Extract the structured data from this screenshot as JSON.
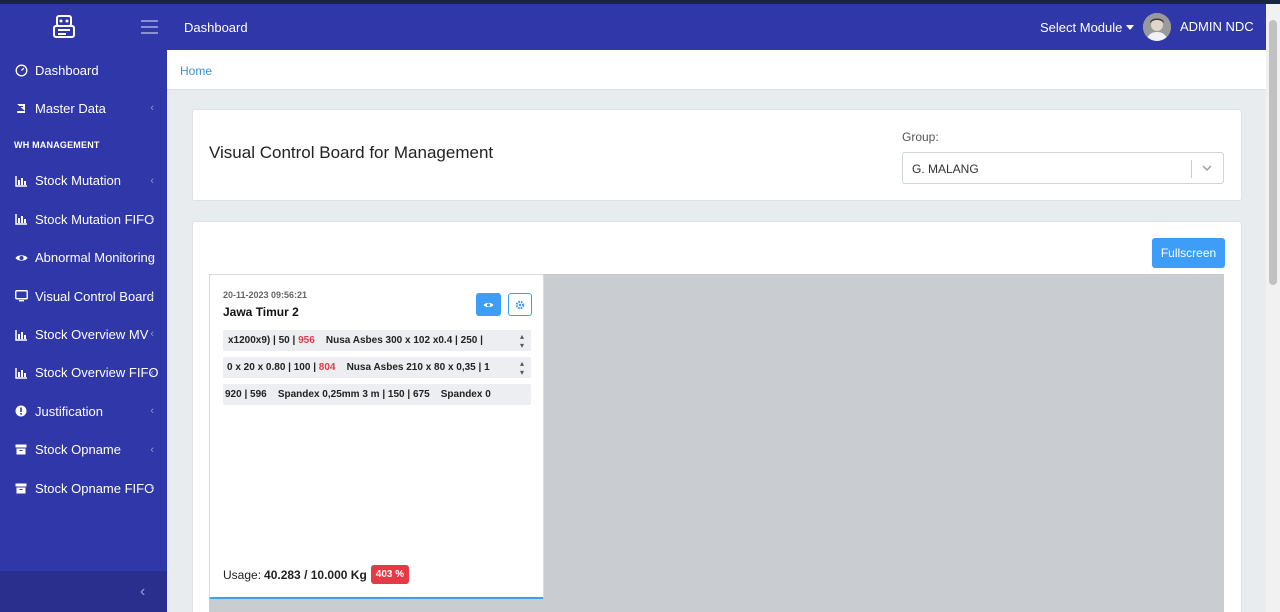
{
  "topbar": {
    "title": "Dashboard",
    "module_select": "Select Module",
    "user_name": "ADMIN NDC"
  },
  "sidebar": {
    "items": [
      {
        "label": "Dashboard",
        "icon": "dashboard-icon",
        "has_chevron": false
      },
      {
        "label": "Master Data",
        "icon": "book-icon",
        "has_chevron": true
      }
    ],
    "section_header": "WH MANAGEMENT",
    "wh_items": [
      {
        "label": "Stock Mutation",
        "icon": "bar-chart-icon"
      },
      {
        "label": "Stock Mutation FIFO",
        "icon": "bar-chart-icon"
      },
      {
        "label": "Abnormal Monitoring",
        "icon": "eye-icon"
      },
      {
        "label": "Visual Control Board",
        "icon": "monitor-icon"
      },
      {
        "label": "Stock Overview MV",
        "icon": "bar-chart-icon"
      },
      {
        "label": "Stock Overview FIFO",
        "icon": "bar-chart-icon"
      },
      {
        "label": "Justification",
        "icon": "exclamation-circle-icon"
      },
      {
        "label": "Stock Opname",
        "icon": "archive-icon"
      },
      {
        "label": "Stock Opname FIFO",
        "icon": "archive-icon"
      }
    ]
  },
  "breadcrumb": {
    "home": "Home"
  },
  "header_card": {
    "title": "Visual Control Board for Management",
    "group_label": "Group:",
    "group_value": "G. MALANG"
  },
  "board": {
    "fullscreen_label": "Fullscreen",
    "warehouse": {
      "timestamp": "20-11-2023 09:56:21",
      "name": "Jawa Timur 2",
      "tickers": [
        {
          "parts": [
            {
              "t": "x1200x9) | 50 | "
            },
            {
              "t": "956",
              "red": true
            },
            {
              "t": "    Nusa Asbes 300 x 102 x0.4 | 250 | "
            }
          ]
        },
        {
          "parts": [
            {
              "t": "0 x 20 x 0.80 | 100 | "
            },
            {
              "t": "804",
              "red": true
            },
            {
              "t": "    Nusa Asbes 210 x 80 x 0,35 | 1"
            }
          ]
        },
        {
          "parts": [
            {
              "t": "920 | 596    Spandex 0,25mm 3 m | 150 | 675    Spandex 0"
            }
          ]
        }
      ],
      "usage_label": "Usage:",
      "usage_value": "40.283 / 10.000 Kg",
      "usage_percent": "403 %"
    }
  },
  "colors": {
    "sidebar": "#3037a8",
    "accent": "#3d9df7",
    "danger": "#e63946"
  }
}
